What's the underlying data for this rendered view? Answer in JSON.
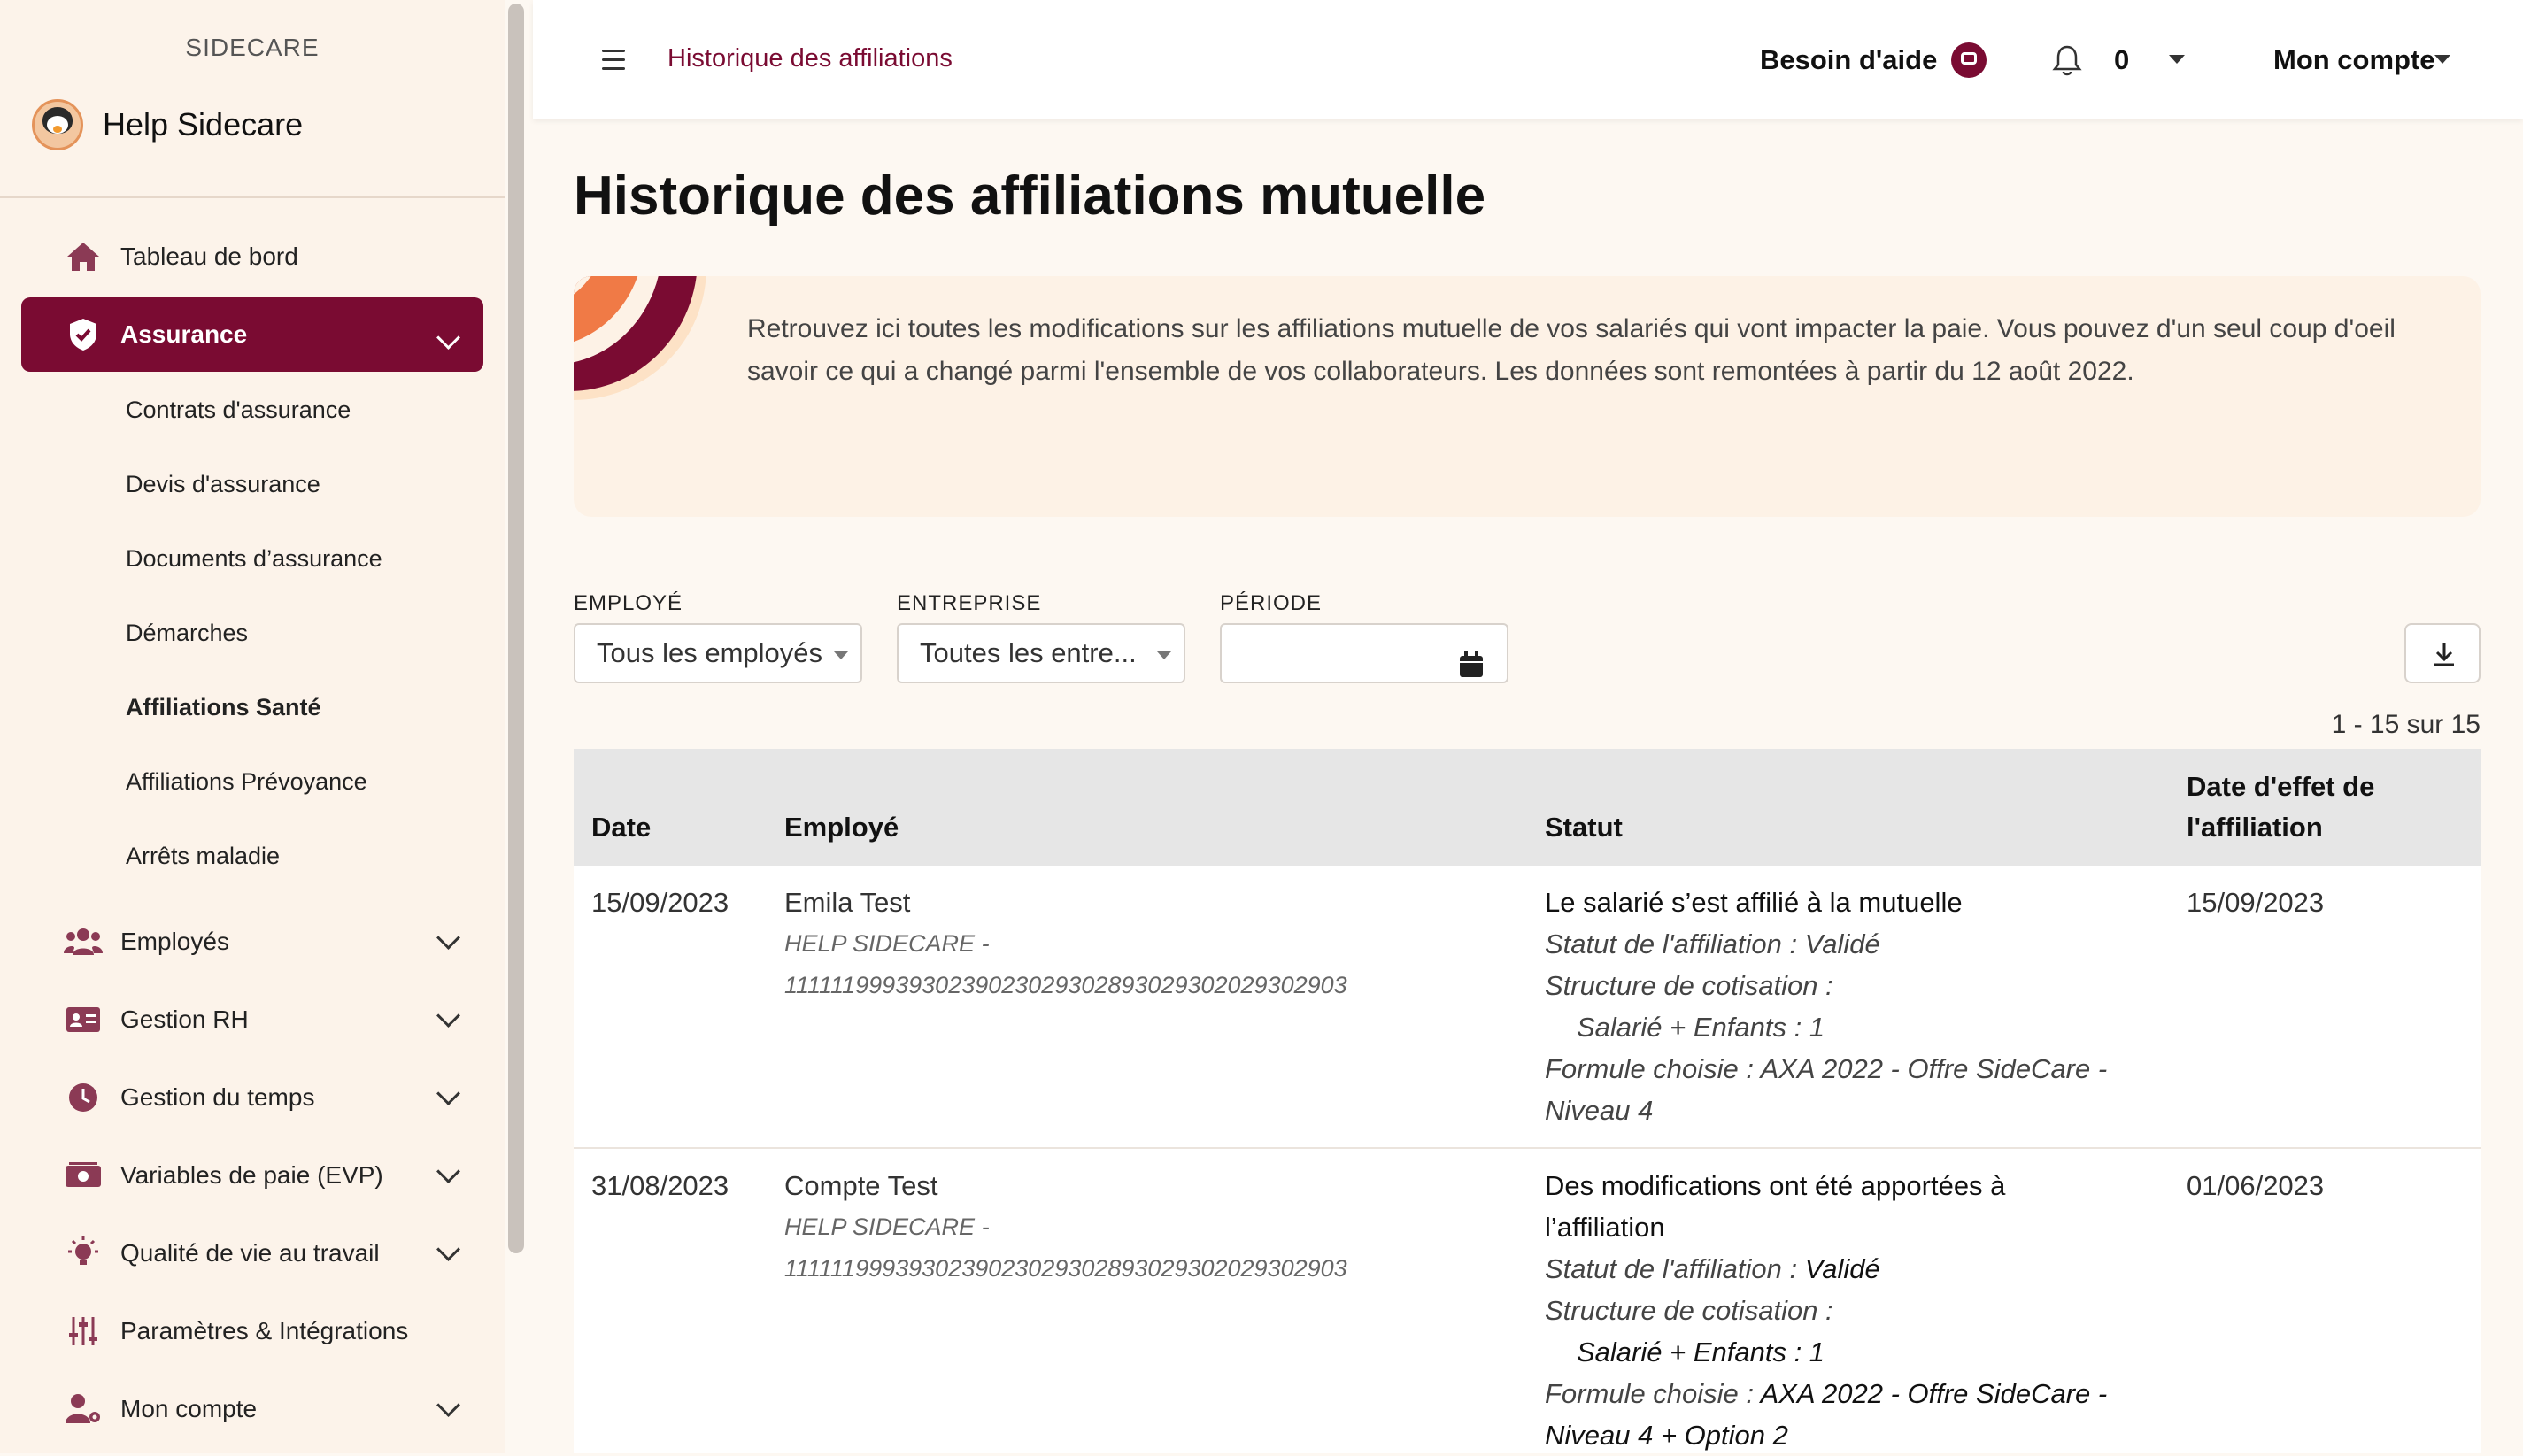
{
  "sidebar": {
    "brand_top": "SIDECARE",
    "brand_name": "Help Sidecare",
    "nav": [
      {
        "label": "Tableau de bord",
        "icon": "home-icon"
      },
      {
        "label": "Assurance",
        "icon": "shield-check-icon",
        "active": true
      },
      {
        "label": "Employés",
        "icon": "users-icon"
      },
      {
        "label": "Gestion RH",
        "icon": "id-card-icon"
      },
      {
        "label": "Gestion du temps",
        "icon": "clock-icon"
      },
      {
        "label": "Variables de paie (EVP)",
        "icon": "money-icon"
      },
      {
        "label": "Qualité de vie au travail",
        "icon": "lightbulb-icon"
      },
      {
        "label": "Paramètres & Intégrations",
        "icon": "sliders-icon"
      },
      {
        "label": "Mon compte",
        "icon": "user-gear-icon"
      }
    ],
    "sub": [
      {
        "label": "Contrats d'assurance"
      },
      {
        "label": "Devis d'assurance"
      },
      {
        "label": "Documents d’assurance"
      },
      {
        "label": "Démarches"
      },
      {
        "label": "Affiliations Santé",
        "current": true
      },
      {
        "label": "Affiliations Prévoyance"
      },
      {
        "label": "Arrêts maladie"
      }
    ]
  },
  "header": {
    "title": "Historique des affiliations",
    "help": "Besoin d'aide",
    "notif_count": "0",
    "account": "Mon compte"
  },
  "main": {
    "title": "Historique des affiliations mutuelle",
    "info": "Retrouvez ici toutes les modifications sur les affiliations mutuelle de vos salariés qui vont impacter la paie. Vous pouvez d'un seul coup d'oeil savoir ce qui a changé parmi l'ensemble de vos collaborateurs. Les données sont remontées à partir du 12 août 2022.",
    "filters": {
      "employe_label": "EMPLOYÉ",
      "employe_value": "Tous les employés",
      "entreprise_label": "ENTREPRISE",
      "entreprise_value": "Toutes les entre...",
      "periode_label": "PÉRIODE",
      "periode_value": ""
    },
    "pagination": "1 - 15 sur 15",
    "table": {
      "headers": {
        "date": "Date",
        "employe": "Employé",
        "statut": "Statut",
        "effet_1": "Date d'effet de",
        "effet_2": "l'affiliation"
      },
      "rows": [
        {
          "date": "15/09/2023",
          "name": "Emila Test",
          "company": "HELP SIDECARE -",
          "code": "1111119993930239023029302893029302029302903",
          "status_title": "Le salarié s’est affilié à la mutuelle",
          "s1": "Statut de l'affiliation : Validé",
          "s2": "Structure de cotisation :",
          "s3": "Salarié + Enfants : 1",
          "s4": "Formule choisie : AXA 2022 - Offre SideCare -",
          "s5": "Niveau 4",
          "effet": "15/09/2023"
        },
        {
          "date": "31/08/2023",
          "name": "Compte Test",
          "company": "HELP SIDECARE -",
          "code": "1111119993930239023029302893029302029302903",
          "status_title_1": "Des modifications ont été apportées à",
          "status_title_2": "l’affiliation",
          "s1_label": "Statut de l'affiliation : ",
          "s1_value": "Validé",
          "s2": "Structure de cotisation :",
          "s3": "Salarié + Enfants : 1",
          "s4_label": "Formule choisie : ",
          "s4_value": "AXA 2022 - Offre SideCare -",
          "s5": "Niveau 4 + Option 2",
          "effet": "01/06/2023"
        }
      ]
    }
  }
}
